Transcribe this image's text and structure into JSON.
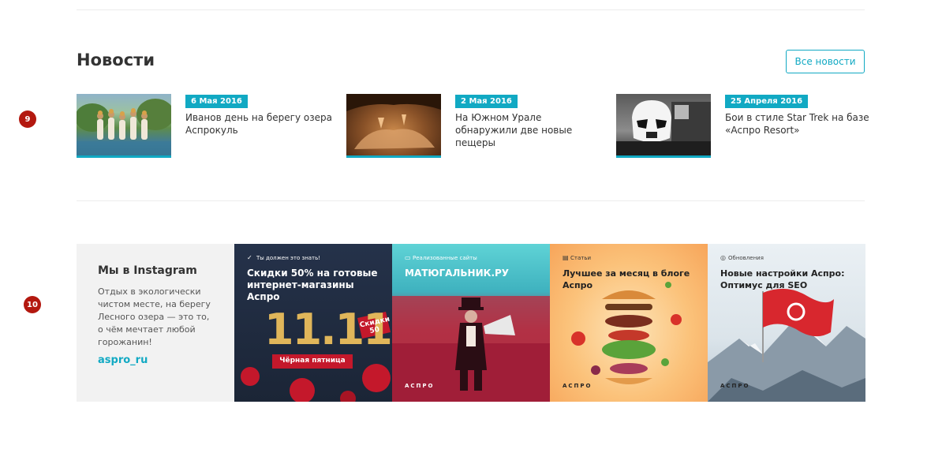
{
  "markers": [
    "9",
    "10"
  ],
  "news": {
    "title": "Новости",
    "all_label": "Все новости",
    "items": [
      {
        "date": "6 Мая 2016",
        "text": "Иванов день на берегу озера Аспрокуль"
      },
      {
        "date": "2 Мая 2016",
        "text": "На Южном Урале обнаружили две новые пещеры"
      },
      {
        "date": "25 Апреля 2016",
        "text": "Бои в стиле Star Trek на базе «Аспро Resort»"
      }
    ]
  },
  "instagram": {
    "title": "Мы в Instagram",
    "text": "Отдых в экологически чистом месте, на берегу Лесного озера — это то, о чём мечтает любой горожанин!",
    "link": "aspro_ru",
    "posts": [
      {
        "label": "Ты должен это знать!",
        "heading": "Скидки 50% на готовые интернет-магазины Аспро",
        "big": "11.11",
        "tag": "Скидки 50",
        "ribbon": "Чёрная пятница",
        "brand": ""
      },
      {
        "label": "Реализованные сайты",
        "heading": "МАТЮГАЛЬНИК.РУ",
        "brand": "АСПРО"
      },
      {
        "label": "Статьи",
        "heading": "Лучшее за месяц в блоге Аспро",
        "brand": "АСПРО"
      },
      {
        "label": "Обновления",
        "heading": "Новые настройки Аспро: Оптимус для SEO",
        "brand": "АСПРО"
      }
    ]
  },
  "colors": {
    "accent": "#11a9c3",
    "marker": "#b3180f",
    "tile_bg": "#f2f2f2"
  }
}
